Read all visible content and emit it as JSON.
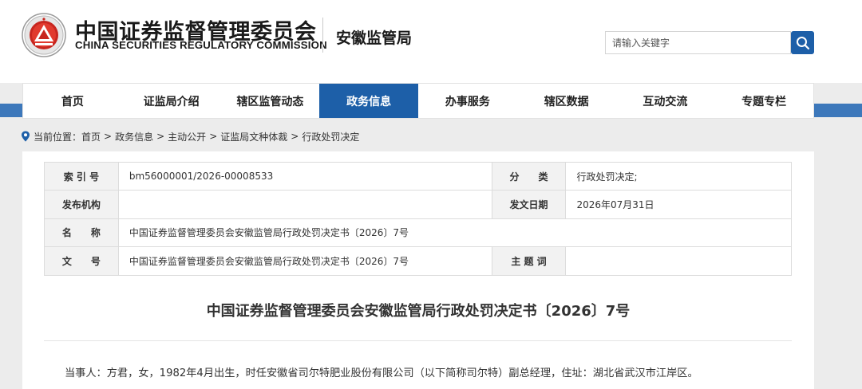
{
  "header": {
    "logo_cn": "中国证券监督管理委员会",
    "logo_en": "CHINA SECURITIES REGULATORY COMMISSION",
    "branch": "安徽监管局"
  },
  "search": {
    "placeholder": "请输入关键字",
    "icon": "search-icon"
  },
  "nav": {
    "items": [
      {
        "label": "首页"
      },
      {
        "label": "证监局介绍"
      },
      {
        "label": "辖区监管动态"
      },
      {
        "label": "政务信息",
        "active": true
      },
      {
        "label": "办事服务"
      },
      {
        "label": "辖区数据"
      },
      {
        "label": "互动交流"
      },
      {
        "label": "专题专栏"
      }
    ]
  },
  "breadcrumb": {
    "prefix": "当前位置：",
    "items": [
      "首页",
      "政务信息",
      "主动公开",
      "证监局文种体裁",
      "行政处罚决定"
    ],
    "separator": ">"
  },
  "meta": {
    "index_label": "索 引 号",
    "index_value": "bm56000001/2026-00008533",
    "category_label": "分　　类",
    "category_value": "行政处罚决定;",
    "publisher_label": "发布机构",
    "publisher_value": "",
    "date_label": "发文日期",
    "date_value": "2026年07月31日",
    "name_label": "名　　称",
    "name_value": "中国证券监督管理委员会安徽监管局行政处罚决定书〔2026〕7号",
    "docno_label": "文　　号",
    "docno_value": "中国证券监督管理委员会安徽监管局行政处罚决定书〔2026〕7号",
    "keywords_label": "主 题 词",
    "keywords_value": ""
  },
  "document": {
    "title": "中国证券监督管理委员会安徽监管局行政处罚决定书〔2026〕7号",
    "paragraph_1": "当事人：方君，女，1982年4月出生，时任安徽省司尔特肥业股份有限公司（以下简称司尔特）副总经理，住址：湖北省武汉市江岸区。"
  },
  "colors": {
    "accent": "#1d5fa8",
    "nav_band": "#3d78bb",
    "page_bg": "#ececec"
  }
}
